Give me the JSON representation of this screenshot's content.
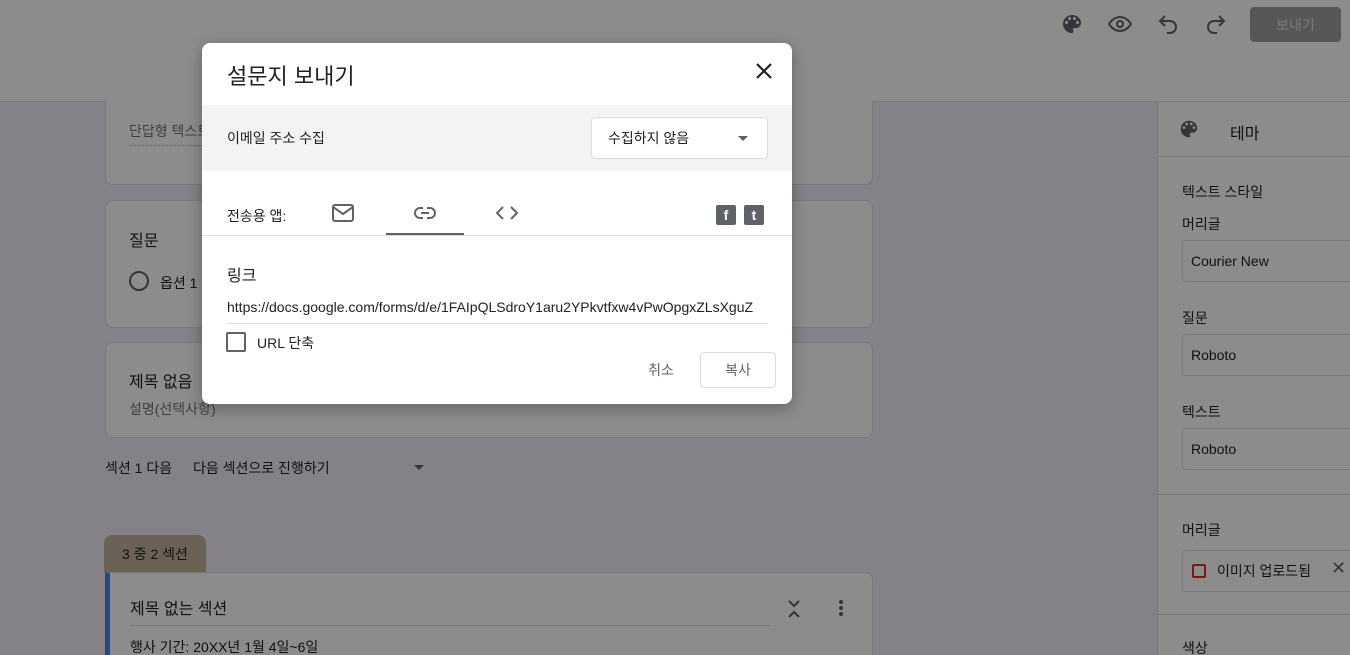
{
  "topbar": {
    "send_label": "보내기",
    "icons": [
      "palette-icon",
      "preview-icon",
      "undo-icon",
      "redo-icon"
    ]
  },
  "form": {
    "card1": {
      "short_answer_placeholder": "단답형 텍스트"
    },
    "card2": {
      "question": "질문",
      "option": "옵션 1"
    },
    "card3": {
      "title": "제목 없음",
      "description": "설명(선택사항)"
    },
    "after_section": {
      "label": "섹션 1 다음",
      "value": "다음 섹션으로 진행하기"
    },
    "section_tab": "3 중 2 섹션",
    "card4": {
      "title": "제목 없는 섹션",
      "text": "행사 기간: 20XX년 1월 4일~6일"
    }
  },
  "theme_panel": {
    "title": "테마",
    "text_style_label": "텍스트 스타일",
    "header_label": "머리글",
    "header_font": "Courier New",
    "question_label": "질문",
    "question_font": "Roboto",
    "text_label": "텍스트",
    "text_font": "Roboto",
    "header_image_label": "머리글",
    "header_image_value": "이미지 업로드됨",
    "color_label": "색상"
  },
  "dialog": {
    "title": "설문지 보내기",
    "email_label": "이메일 주소 수집",
    "email_value": "수집하지 않음",
    "send_via_label": "전송용 앱:",
    "link_heading": "링크",
    "link_url": "https://docs.google.com/forms/d/e/1FAIpQLSdroY1aru2YPkvtfxw4vPwOpgxZLsXguZ",
    "shorten_label": "URL 단축",
    "cancel_label": "취소",
    "copy_label": "복사",
    "social": {
      "facebook": "f",
      "twitter": "t"
    }
  }
}
